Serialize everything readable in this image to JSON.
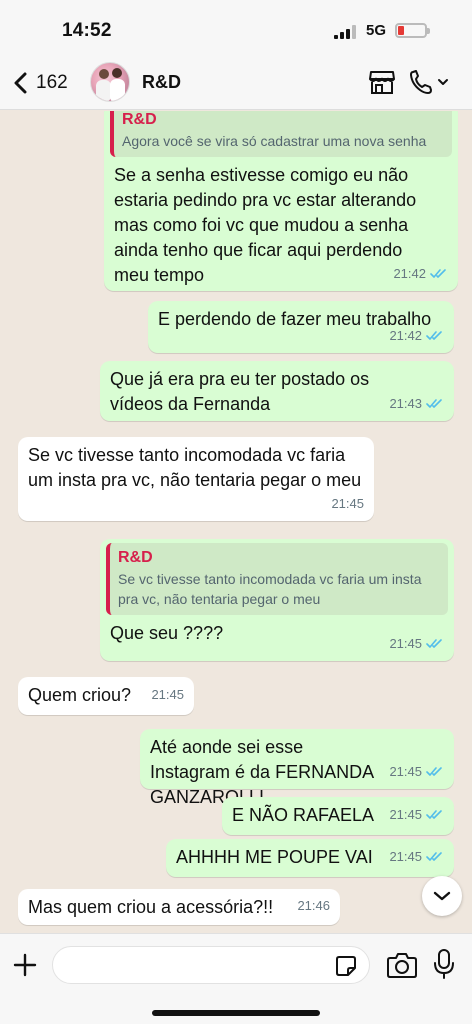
{
  "status_bar": {
    "time": "14:52",
    "network": "5G",
    "battery_color": "#e53935"
  },
  "header": {
    "back_count": "162",
    "chat_name": "R&D",
    "icons": [
      "chevron-left-icon",
      "storefront-icon",
      "phone-icon",
      "chevron-down-icon"
    ]
  },
  "messages": [
    {
      "direction": "out",
      "quote_author": "R&D",
      "quote_text": "Agora você se vira só cadastrar uma nova senha",
      "text": "Se a senha estivesse comigo eu não estaria pedindo pra vc estar alterando mas como foi vc que mudou a senha ainda tenho que ficar aqui perdendo meu tempo",
      "time": "21:42"
    },
    {
      "direction": "out",
      "text": "E perdendo de fazer meu trabalho",
      "time": "21:42"
    },
    {
      "direction": "out",
      "text": "Que já era pra eu ter postado os vídeos da Fernanda",
      "time": "21:43"
    },
    {
      "direction": "in",
      "text": "Se vc tivesse tanto incomodada vc faria um insta pra vc, não tentaria pegar o meu",
      "time": "21:45"
    },
    {
      "direction": "out",
      "quote_author": "R&D",
      "quote_text": "Se vc tivesse tanto incomodada vc faria um insta pra vc, não tentaria pegar o meu",
      "text": "Que seu ????",
      "time": "21:45"
    },
    {
      "direction": "in",
      "text": "Quem criou?",
      "time": "21:45"
    },
    {
      "direction": "out",
      "text": "Até aonde sei esse Instagram é da FERNANDA GANZAROLLI",
      "time": "21:45"
    },
    {
      "direction": "out",
      "text": "E NÃO RAFAELA",
      "time": "21:45"
    },
    {
      "direction": "out",
      "text": "AHHHH ME POUPE VAI",
      "time": "21:45"
    },
    {
      "direction": "in",
      "text": "Mas quem criou a acessória?!!",
      "time": "21:46"
    }
  ],
  "input": {
    "value": "",
    "placeholder": ""
  },
  "colors": {
    "outgoing_bubble": "#d9fdd3",
    "incoming_bubble": "#ffffff",
    "quote_accent": "#d6204c",
    "read_ticks": "#53bdeb",
    "wallpaper": "#efe7de"
  }
}
